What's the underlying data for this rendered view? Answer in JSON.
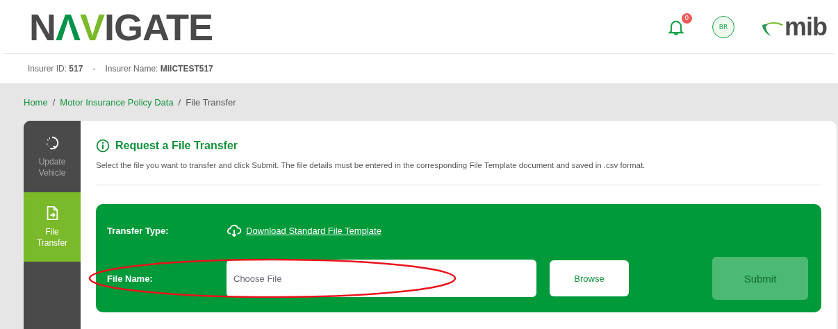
{
  "header": {
    "logo": [
      {
        "text": "N",
        "color": "#4a4a4a"
      },
      {
        "text": "Λ",
        "color": "#00944a"
      },
      {
        "text": "V",
        "color": "#7ab929"
      },
      {
        "text": "IGATE",
        "color": "#4a4a4a"
      }
    ],
    "notifications": {
      "count": "0"
    },
    "avatar": "BR",
    "brand": "mib"
  },
  "insurer": {
    "id_label": "Insurer ID:",
    "id": "517",
    "separator": "-",
    "name_label": "Insurer Name:",
    "name": "MIICTEST517"
  },
  "breadcrumb_separator": "/",
  "breadcrumb": [
    {
      "label": "Home",
      "link": true
    },
    {
      "label": "Motor Insurance Policy Data",
      "link": true
    },
    {
      "label": "File Transfer",
      "link": false
    }
  ],
  "sidebar": {
    "items": [
      {
        "kind": "update",
        "label": "Update\nVehicle",
        "selected": false
      },
      {
        "kind": "file",
        "label": "File\nTransfer",
        "selected": true
      }
    ]
  },
  "panel": {
    "title": "Request a File Transfer",
    "description": "Select the file you want to transfer and click Submit. The file details must be entered in the corresponding File Template document and saved in .csv format.",
    "transfer_type_label": "Transfer Type:",
    "download_link": "Download Standard File Template",
    "file_name_label": "File Name:",
    "file_placeholder": "Choose File",
    "browse": "Browse",
    "submit": {
      "label": "Submit",
      "disabled": true
    }
  },
  "annotation": {
    "kind": "ellipse"
  }
}
